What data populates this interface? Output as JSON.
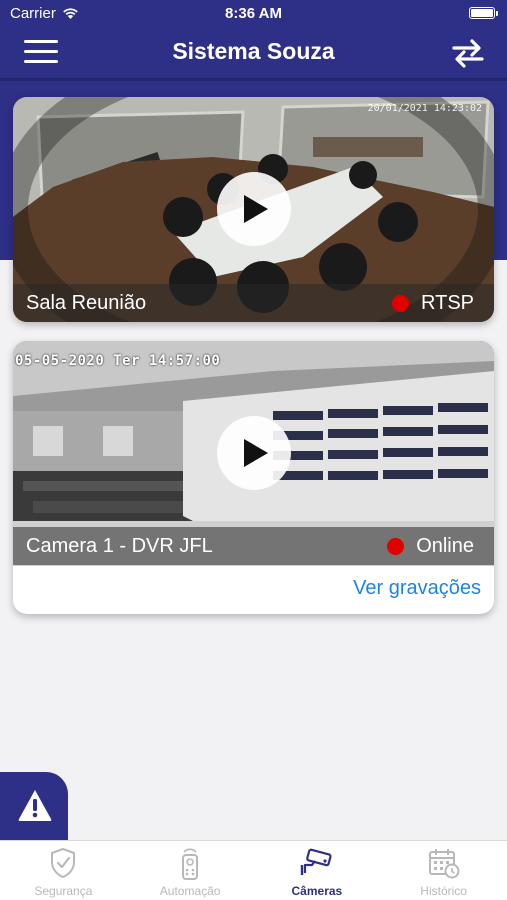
{
  "status_bar": {
    "carrier": "Carrier",
    "time": "8:36 AM"
  },
  "navbar": {
    "title": "Sistema Souza",
    "menu_icon": "hamburger-menu-icon",
    "swap_icon": "swap-arrows-icon"
  },
  "cameras": [
    {
      "name": "Sala Reunião",
      "status": "RTSP",
      "status_color": "#e00000",
      "timestamp": "20/01/2021 14:23:02",
      "play_icon": "play-icon"
    },
    {
      "name": "Camera 1 - DVR JFL",
      "status": "Online",
      "status_color": "#e00000",
      "timestamp": "05-05-2020 Ter 14:57:00",
      "play_icon": "play-icon",
      "recordings_link": "Ver gravações"
    }
  ],
  "alert_button": {
    "icon": "warning-icon"
  },
  "tabs": [
    {
      "label": "Segurança",
      "icon": "shield-check-icon",
      "active": false
    },
    {
      "label": "Automação",
      "icon": "remote-control-icon",
      "active": false
    },
    {
      "label": "Câmeras",
      "icon": "cctv-camera-icon",
      "active": true
    },
    {
      "label": "Histórico",
      "icon": "calendar-history-icon",
      "active": false
    }
  ],
  "colors": {
    "primary": "#2e2f86",
    "link": "#1d83e6",
    "status_dot": "#e00000",
    "tab_inactive": "#b8b8b8"
  }
}
